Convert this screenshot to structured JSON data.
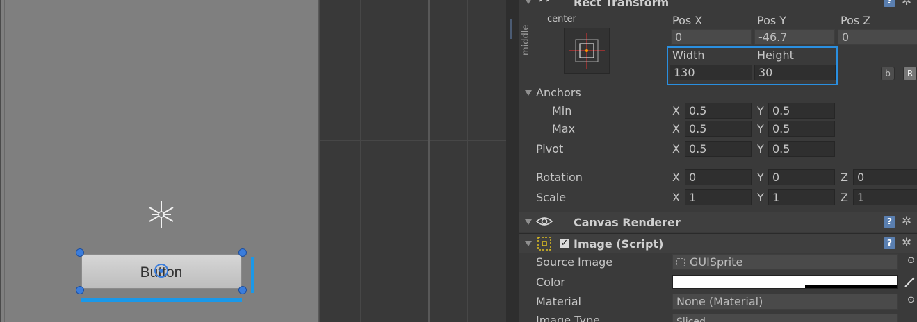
{
  "scene": {
    "button_label": "Button"
  },
  "inspector": {
    "rect_transform": {
      "title": "Rect Transform",
      "anchor_preset_h": "center",
      "anchor_preset_v": "middle",
      "pos_x_label": "Pos X",
      "pos_y_label": "Pos Y",
      "pos_z_label": "Pos Z",
      "pos_x": "0",
      "pos_y": "-46.7",
      "pos_z": "0",
      "width_label": "Width",
      "height_label": "Height",
      "width": "130",
      "height": "30",
      "blueprint_button": "b",
      "raw_button": "R",
      "anchors_label": "Anchors",
      "min_label": "Min",
      "max_label": "Max",
      "pivot_label": "Pivot",
      "rotation_label": "Rotation",
      "scale_label": "Scale",
      "x": "X",
      "y": "Y",
      "z": "Z",
      "anchor_min_x": "0.5",
      "anchor_min_y": "0.5",
      "anchor_max_x": "0.5",
      "anchor_max_y": "0.5",
      "pivot_x": "0.5",
      "pivot_y": "0.5",
      "rotation_x": "0",
      "rotation_y": "0",
      "rotation_z": "0",
      "scale_x": "1",
      "scale_y": "1",
      "scale_z": "1"
    },
    "canvas_renderer": {
      "title": "Canvas Renderer"
    },
    "image_script": {
      "title": "Image (Script)",
      "source_image_label": "Source Image",
      "source_image_value": "GUISprite",
      "color_label": "Color",
      "material_label": "Material",
      "material_value": "None (Material)",
      "image_type_label": "Image Type",
      "image_type_value": "Sliced"
    },
    "help_glyph": "?",
    "colors": {
      "highlight": "#2a8fe0",
      "handle": "#3b7ddc",
      "size_bar": "#1a98e8"
    }
  }
}
